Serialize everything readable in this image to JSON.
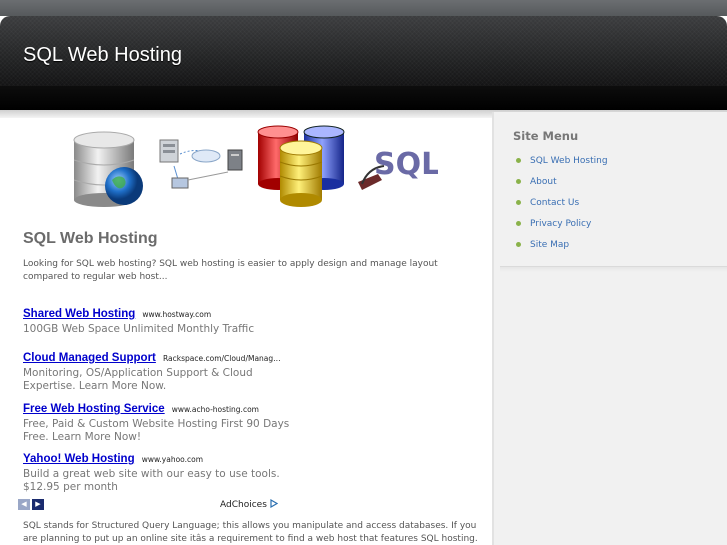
{
  "header": {
    "site_title": "SQL Web Hosting"
  },
  "banner": {
    "sql_logo_text": "SQL",
    "icons": [
      "database-globe-icon",
      "network-servers-icon",
      "database-stack-icon",
      "sql-logo-icon"
    ]
  },
  "main": {
    "heading": "SQL Web Hosting",
    "intro": "Looking for SQL web hosting? SQL web hosting is easier to apply design and manage layout compared to regular web host...",
    "ads": [
      {
        "title": "Shared Web Hosting",
        "url": "www.hostway.com",
        "desc": "100GB Web Space Unlimited Monthly Traffic"
      },
      {
        "title": "Cloud Managed Support",
        "url": "Rackspace.com/Cloud/Manag…",
        "desc": "Monitoring, OS/Application Support & Cloud Expertise. Learn More Now."
      },
      {
        "title": "Free Web Hosting Service",
        "url": "www.acho-hosting.com",
        "desc": "Free, Paid & Custom Website Hosting First 90 Days Free. Learn More Now!"
      },
      {
        "title": "Yahoo! Web Hosting",
        "url": "www.yahoo.com",
        "desc": "Build a great web site with our easy to use tools. $12.95 per month"
      }
    ],
    "adchoices_label": "AdChoices",
    "ad_prev_glyph": "◀",
    "ad_next_glyph": "▶",
    "body_text": "SQL stands for Structured Query Language; this allows you manipulate and access databases. If you are planning to put up an online site itâs a requirement to find a web host that features SQL hosting. SQL database"
  },
  "sidebar": {
    "heading": "Site Menu",
    "items": [
      {
        "label": "SQL Web Hosting"
      },
      {
        "label": "About"
      },
      {
        "label": "Contact Us"
      },
      {
        "label": "Privacy Policy"
      },
      {
        "label": "Site Map"
      }
    ]
  },
  "colors": {
    "link": "#3a6fb3",
    "ad_link": "#0000cc",
    "bullet": "#8ab24a",
    "header_dark": "#151516"
  }
}
